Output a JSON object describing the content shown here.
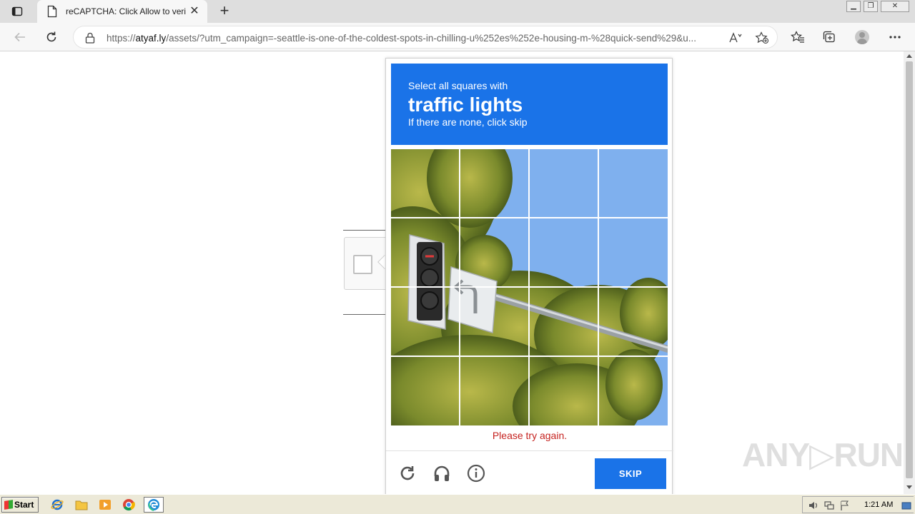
{
  "browser": {
    "tab_title": "reCAPTCHA: Click Allow to veri",
    "tab_close": "✕",
    "new_tab": "+",
    "url_prefix": "https://",
    "url_host": "atyaf.ly",
    "url_path": "/assets/?utm_campaign=-seattle-is-one-of-the-coldest-spots-in-chilling-u%252es%252e-housing-m-%28quick-send%29&u..."
  },
  "captcha": {
    "instruction": "Select all squares with",
    "target": "traffic lights",
    "note": "If there are none, click skip",
    "error": "Please try again.",
    "skip_label": "SKIP",
    "header_color": "#1a73e8",
    "error_color": "#c5221f"
  },
  "watermark": "ANY▷RUN",
  "taskbar": {
    "start_label": "Start",
    "clock": "1:21 AM"
  }
}
